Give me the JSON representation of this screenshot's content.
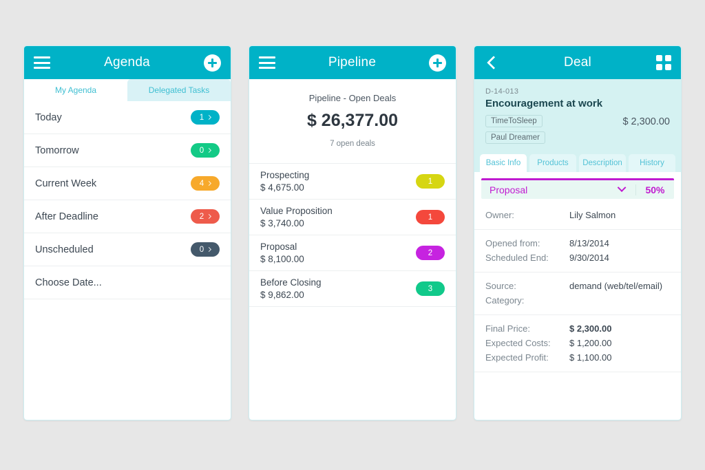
{
  "agenda": {
    "appbar": {
      "title": "Agenda",
      "menu_icon": "hamburger-icon",
      "add_icon": "plus-circle-icon"
    },
    "tabs": [
      {
        "label": "My Agenda",
        "active": true
      },
      {
        "label": "Delegated Tasks",
        "active": false
      }
    ],
    "rows": [
      {
        "label": "Today",
        "count": "1",
        "color": "#00b2c7"
      },
      {
        "label": "Tomorrow",
        "count": "0",
        "color": "#13ca86"
      },
      {
        "label": "Current Week",
        "count": "4",
        "color": "#f7a92b"
      },
      {
        "label": "After Deadline",
        "count": "2",
        "color": "#ee5b4b"
      },
      {
        "label": "Unscheduled",
        "count": "0",
        "color": "#44596b"
      },
      {
        "label": "Choose Date...",
        "count": "",
        "color": ""
      }
    ]
  },
  "pipeline": {
    "appbar": {
      "title": "Pipeline",
      "menu_icon": "hamburger-icon",
      "add_icon": "plus-circle-icon"
    },
    "summary": {
      "caption": "Pipeline - Open Deals",
      "amount": "$ 26,377.00",
      "subtitle": "7 open deals"
    },
    "stages": [
      {
        "name": "Prospecting",
        "amount": "$ 4,675.00",
        "count": "1",
        "color": "#d6d612"
      },
      {
        "name": "Value Proposition",
        "amount": "$ 3,740.00",
        "count": "1",
        "color": "#f4483c"
      },
      {
        "name": "Proposal",
        "amount": "$ 8,100.00",
        "count": "2",
        "color": "#c623e0"
      },
      {
        "name": "Before Closing",
        "amount": "$ 9,862.00",
        "count": "3",
        "color": "#11c98a"
      }
    ]
  },
  "deal": {
    "appbar": {
      "title": "Deal",
      "back_icon": "back-chevron-icon",
      "grid_icon": "grid-icon"
    },
    "header": {
      "code": "D-14-013",
      "name": "Encouragement at work",
      "price": "$ 2,300.00",
      "chips": [
        "TimeToSleep",
        "Paul Dreamer"
      ]
    },
    "tabs": [
      {
        "label": "Basic Info",
        "active": true
      },
      {
        "label": "Products",
        "active": false
      },
      {
        "label": "Description",
        "active": false
      },
      {
        "label": "History",
        "active": false
      }
    ],
    "stage": {
      "value": "Proposal",
      "percent": "50%",
      "accent": "#c01ad0"
    },
    "fields": {
      "owner_label": "Owner:",
      "owner_value": "Lily Salmon",
      "opened_label": "Opened from:",
      "opened_value": "8/13/2014",
      "scheduled_label": "Scheduled End:",
      "scheduled_value": "9/30/2014",
      "source_label": "Source:",
      "source_value": "demand (web/tel/email)",
      "category_label": "Category:",
      "category_value": "",
      "final_price_label": "Final Price:",
      "final_price_value": "$ 2,300.00",
      "expected_costs_label": "Expected Costs:",
      "expected_costs_value": "$ 1,200.00",
      "expected_profit_label": "Expected Profit:",
      "expected_profit_value": "$ 1,100.00"
    }
  },
  "theme": {
    "appbar_color": "#00b2c7",
    "page_background": "#e7e7e7",
    "panel_border": "#cdeef2"
  }
}
